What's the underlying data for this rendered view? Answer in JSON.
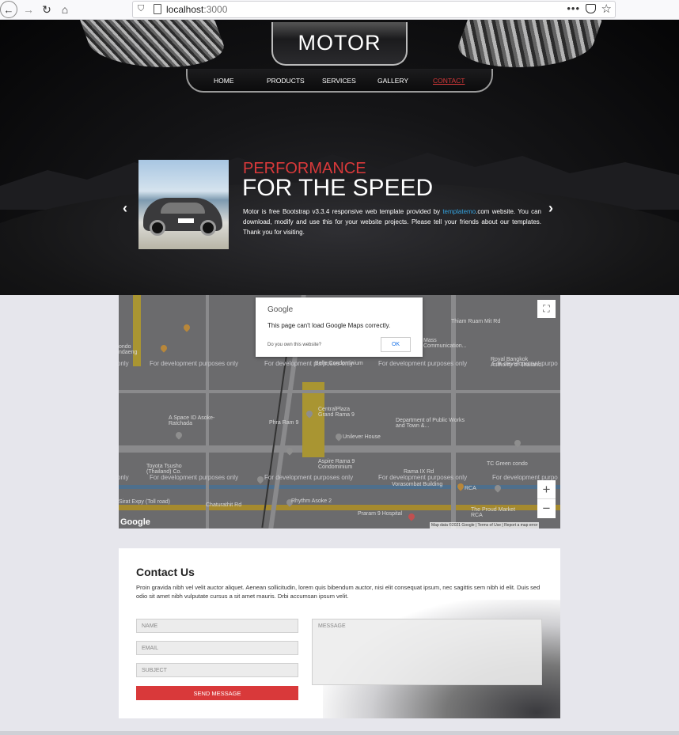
{
  "browser": {
    "url_host": "localhost",
    "url_port": ":3000",
    "more_label": "•••"
  },
  "site": {
    "logo": "MOTOR",
    "nav": [
      "HOME",
      "PRODUCTS",
      "SERVICES",
      "GALLERY",
      "CONTACT"
    ],
    "active_nav": "CONTACT",
    "accent_color": "#d9393a"
  },
  "slider": {
    "subtitle": "PERFORMANCE",
    "title": "FOR THE SPEED",
    "desc_before": "Motor is free Bootstrap v3.3.4 responsive web template provided by ",
    "desc_link": "templatemo",
    "desc_after": ".com website. You can download, modify and use this for your website projects. Please tell your friends about our templates. Thank you for visiting.",
    "prev_icon": "chevron-left-icon",
    "next_icon": "chevron-right-icon"
  },
  "map": {
    "dialog_brand": "Google",
    "dialog_message": "This page can't load Google Maps correctly.",
    "dialog_question": "Do you own this website?",
    "dialog_ok": "OK",
    "watermark": "For development purposes only",
    "watermark_cut": "only",
    "watermark_cut_right": "For development purpo",
    "labels": [
      "A Space ID Asoke-Ratchada",
      "CentralPlaza Grand Rama 9",
      "Phra Ram 9",
      "Unilever House",
      "Department of Public Works and Town &...",
      "Aspire Rama 9 Condominium",
      "Rhythm Asoke 2",
      "Toyota Tsusho (Thailand) Co.",
      "Belle Condominium",
      "Rama IX Rd",
      "Vorasombat Building",
      "RCA",
      "TC Green condo",
      "Praram 9 Hospital",
      "The Proud Market RCA",
      "Chaturathit Rd",
      "Sirat Expy (Toll road)",
      "Thiam Ruam Mit Rd",
      "Mass Communication...",
      "Royal Bangkok Authority of Thailand",
      "ondo ndaeng"
    ],
    "google_mark": "Google",
    "attribution": "Map data ©2021 Google | Terms of Use | Report a map error",
    "zoom_in": "+",
    "zoom_out": "−",
    "fullscreen_icon": "fullscreen-icon"
  },
  "contact": {
    "heading": "Contact Us",
    "intro": "Proin gravida nibh vel velit auctor aliquet. Aenean sollicitudin, lorem quis bibendum auctor, nisi elit consequat ipsum, nec sagittis sem nibh id elit. Duis sed odio sit amet nibh vulputate cursus a sit amet mauris. Drbi accumsan ipsum velit.",
    "name_placeholder": "NAME",
    "email_placeholder": "EMAIL",
    "subject_placeholder": "SUBJECT",
    "message_placeholder": "MESSAGE",
    "send_label": "SEND MESSAGE"
  }
}
